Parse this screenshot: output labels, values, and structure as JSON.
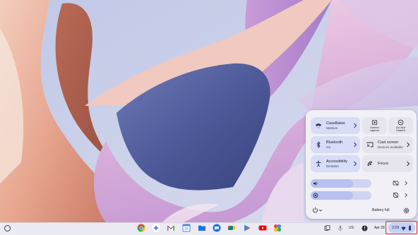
{
  "quick_settings": {
    "network": {
      "title": "CassBaker",
      "subtitle": "Medium"
    },
    "bluetooth": {
      "title": "Bluetooth",
      "subtitle": "On"
    },
    "accessibility": {
      "title": "Accessibility",
      "subtitle": "Dictation"
    },
    "screen_capture": {
      "label_line1": "Screen",
      "label_line2": "capture"
    },
    "do_not_disturb": {
      "label_line1": "Do Not",
      "label_line2": "Disturb"
    },
    "cast_screen": {
      "title": "Cast screen",
      "subtitle": "Devices available"
    },
    "focus": {
      "title": "Focus"
    },
    "volume": {
      "level_percent": 70
    },
    "brightness": {
      "level_percent": 70
    },
    "battery_status": "Battery full"
  },
  "shelf": {
    "apps": [
      "chrome",
      "gemini",
      "gmail",
      "calendar",
      "files",
      "messages",
      "meet",
      "play-store",
      "youtube",
      "photos"
    ],
    "input_method": "US",
    "date": "Apr 28",
    "time": "2:29"
  },
  "colors": {
    "accent": "#c6d0f6",
    "highlight": "#e02b2b"
  }
}
